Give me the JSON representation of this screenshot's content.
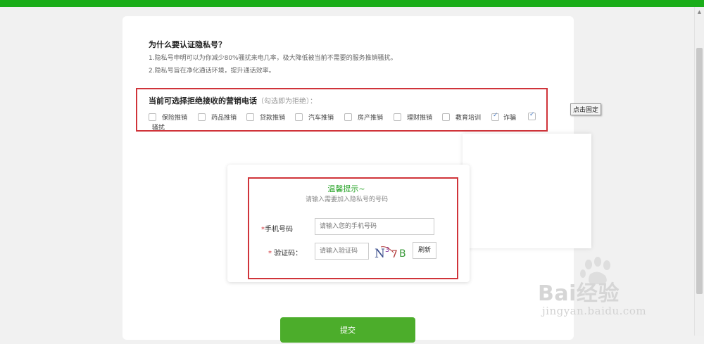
{
  "why": {
    "title": "为什么要认证隐私号？",
    "line1": "1.隐私号申明可以为你减少80%骚扰来电几率，极大降低被当前不需要的服务推销骚扰。",
    "line2": "2.隐私号旨在净化通话环境，提升通话效率。"
  },
  "options": {
    "title": "当前可选择拒绝接收的营销电话",
    "hint": "（勾选即为拒绝）：",
    "items": [
      {
        "label": "保险推销",
        "checked": false
      },
      {
        "label": "药品推销",
        "checked": false
      },
      {
        "label": "贷款推销",
        "checked": false
      },
      {
        "label": "汽车推销",
        "checked": false
      },
      {
        "label": "房产推销",
        "checked": false
      },
      {
        "label": "理财推销",
        "checked": false
      },
      {
        "label": "教育培训",
        "checked": false
      },
      {
        "label": "诈骗",
        "checked": true
      },
      {
        "label": "骚扰",
        "checked": true
      }
    ]
  },
  "tooltip": "点击固定",
  "warm_tip": {
    "title": "温馨提示~",
    "subtitle": "请输入需要加入隐私号的号码"
  },
  "form": {
    "phone_label": "手机号码",
    "phone_placeholder": "请输入您的手机号码",
    "code_label": "验证码：",
    "code_placeholder": "请输入验证码",
    "captcha_text": "N37B",
    "refresh_label": "刷新",
    "required_mark": "*"
  },
  "submit_label": "提交",
  "watermark": {
    "brand": "Bai经验",
    "url": "jingyan.baidu.com"
  },
  "colors": {
    "top_bar": "#1aad19",
    "highlight_border": "#d0343a",
    "submit": "#4cad2b",
    "warm_title": "#2aa52a"
  }
}
